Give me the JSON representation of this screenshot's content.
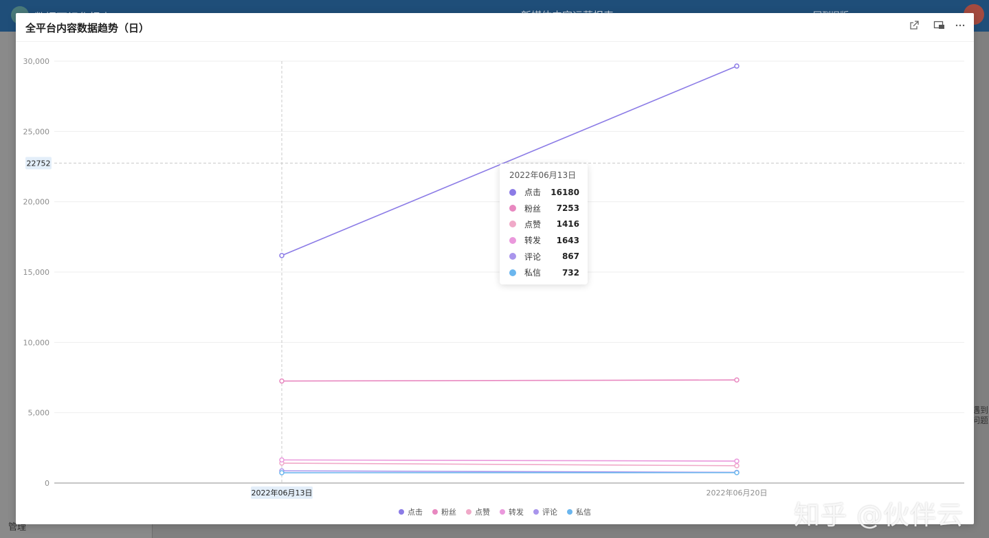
{
  "app": {
    "name": "数据可视化报表",
    "doc_title": "新媒体内容运营报表",
    "back_link": "回到旧版",
    "sidebar_manage": "管理",
    "right_help": "遇到问题"
  },
  "modal": {
    "title": "全平台内容数据趋势（日）",
    "icons": [
      "external-link-icon",
      "fullscreen-icon",
      "more-icon"
    ]
  },
  "watermark": "知乎 @伙伴云",
  "colors": {
    "点击": "#8b7be6",
    "粉丝": "#e888c0",
    "点赞": "#f0a9c8",
    "转发": "#ea98dc",
    "评论": "#a995ec",
    "私信": "#6bb6ee"
  },
  "crosshair": {
    "y_value": "22752",
    "x_value": "2022年06月13日"
  },
  "tooltip": {
    "title": "2022年06月13日",
    "rows": [
      {
        "name": "点击",
        "value": "16180"
      },
      {
        "name": "粉丝",
        "value": "7253"
      },
      {
        "name": "点赞",
        "value": "1416"
      },
      {
        "name": "转发",
        "value": "1643"
      },
      {
        "name": "评论",
        "value": "867"
      },
      {
        "name": "私信",
        "value": "732"
      }
    ]
  },
  "chart_data": {
    "type": "line",
    "title": "全平台内容数据趋势（日）",
    "x": [
      "2022年06月13日",
      "2022年06月20日"
    ],
    "ylim": [
      0,
      30000
    ],
    "yticks": [
      "0",
      "5,000",
      "10,000",
      "15,000",
      "20,000",
      "25,000",
      "30,000"
    ],
    "ytick_values": [
      0,
      5000,
      10000,
      15000,
      20000,
      25000,
      30000
    ],
    "grid": true,
    "legend_position": "bottom",
    "series": [
      {
        "name": "点击",
        "values": [
          16180,
          29650
        ]
      },
      {
        "name": "粉丝",
        "values": [
          7253,
          7330
        ]
      },
      {
        "name": "点赞",
        "values": [
          1416,
          1230
        ]
      },
      {
        "name": "转发",
        "values": [
          1643,
          1560
        ]
      },
      {
        "name": "评论",
        "values": [
          867,
          760
        ]
      },
      {
        "name": "私信",
        "values": [
          732,
          740
        ]
      }
    ]
  }
}
